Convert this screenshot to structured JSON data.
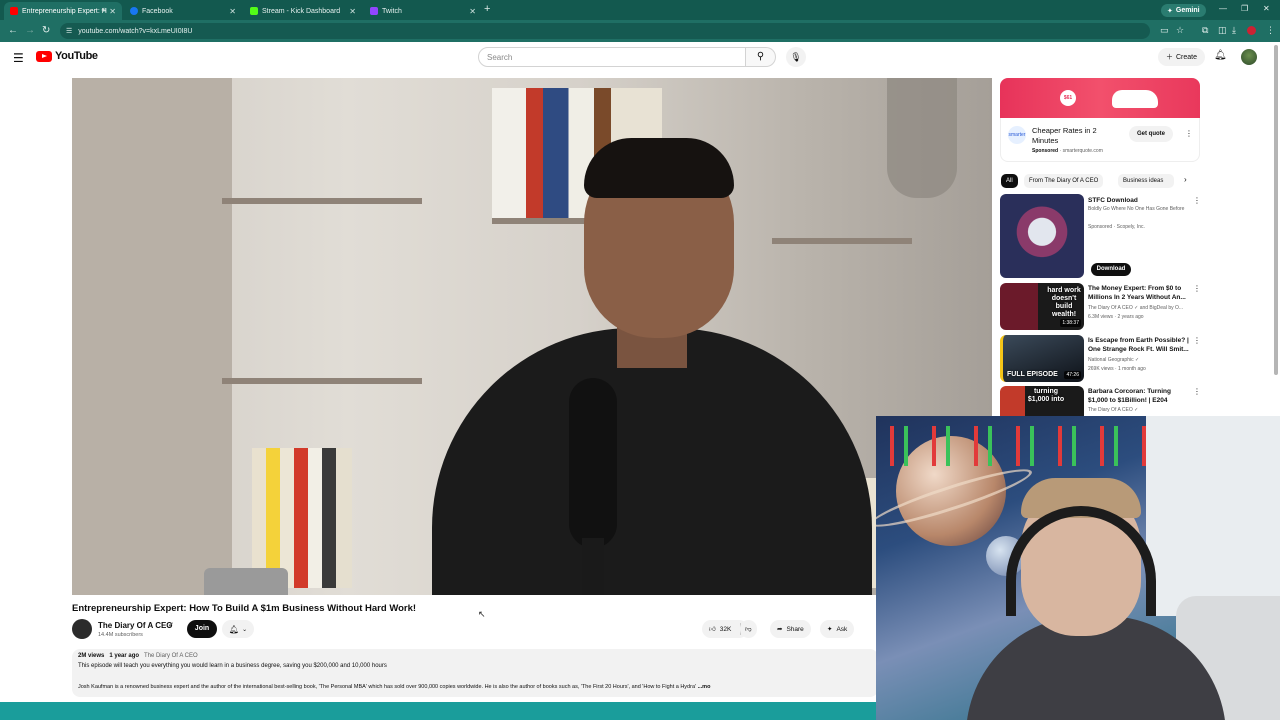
{
  "browser": {
    "tabs": [
      {
        "label": "Entrepreneurship Expert: H",
        "active": true,
        "favicon_color": "#ff0000"
      },
      {
        "label": "Facebook",
        "active": false,
        "favicon_color": "#1877f2"
      },
      {
        "label": "Stream - Kick Dashboard",
        "active": false,
        "favicon_color": "#53fc18"
      },
      {
        "label": "Twitch",
        "active": false,
        "favicon_color": "#9146ff"
      }
    ],
    "new_tab": "+",
    "gemini_label": "Gemini",
    "url": "youtube.com/watch?v=kxLmeUI0I8U",
    "accent": "#13594f"
  },
  "youtube": {
    "logo_text": "YouTube",
    "search_placeholder": "Search",
    "create_label": "Create"
  },
  "video": {
    "title": "Entrepreneurship Expert: How To Build A $1m Business Without Hard Work!",
    "channel": "The Diary Of A CEO",
    "subscribers": "14.4M subscribers",
    "join_label": "Join",
    "likes": "32K",
    "share_label": "Share",
    "ask_label": "Ask"
  },
  "description": {
    "views": "2M views",
    "age": "1 year ago",
    "channel_tag": "The Diary Of A CEO",
    "line1": "This episode will teach you everything you would learn in a business degree, saving you $200,000 and 10,000 hours",
    "line2": "Josh Kaufman is a renowned business expert and the author of the international best-selling book, 'The Personal MBA' which has sold over 900,000 copies worldwide. He is also the author of books such as, 'The First 20 Hours', and 'How to Fight a Hydra'",
    "more": "...mo"
  },
  "ad": {
    "banner_tag": "$61",
    "logo_text": "smarter",
    "title": "Cheaper Rates in 2 Minutes",
    "sponsored": "Sponsored",
    "domain": "smarterquote.com",
    "cta": "Get quote"
  },
  "chips": [
    "All",
    "From The Diary Of A CEO",
    "Business ideas"
  ],
  "recommendations": [
    {
      "title": "STFC Download",
      "sub1": "Boldly Go Where No One Has Gone Before",
      "sub2": "Sponsored · Scopely, Inc.",
      "cta": "Download"
    },
    {
      "title": "The Money Expert: From $0 to Millions In 2 Years Without An...",
      "sub1": "The Diary Of A CEO ✓ and BigDeal by O...",
      "sub2": "6.3M views · 2 years ago",
      "duration": "1:38:37",
      "thumb_text": "hard work doesn't build wealth!"
    },
    {
      "title": "Is Escape from Earth Possible? | One Strange Rock Ft. Will Smit...",
      "sub1": "National Geographic ✓",
      "sub2": "269K views · 1 month ago",
      "duration": "47:26",
      "thumb_text": "FULL EPISODE"
    },
    {
      "title": "Barbara Corcoran: Turning $1,000 to $1Billion! | E204",
      "sub1": "The Diary Of A CEO ✓",
      "sub2": "",
      "thumb_text": "turning $1,000 into"
    }
  ]
}
